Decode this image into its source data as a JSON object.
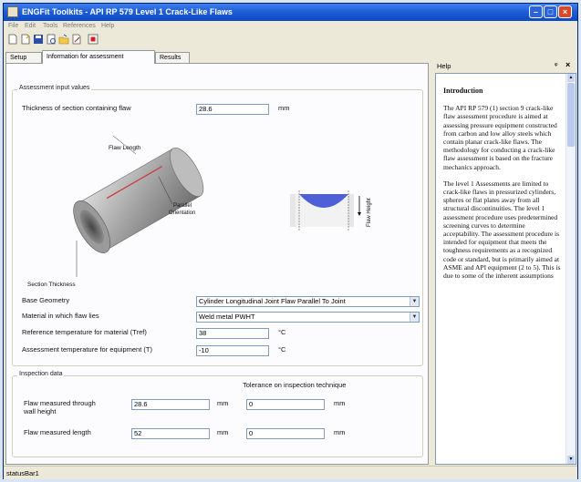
{
  "window": {
    "title": "ENGFit Toolkits - API RP 579 Level 1 Crack-Like Flaws"
  },
  "menu": {
    "items": [
      "File",
      "Edit",
      "Tools",
      "References",
      "Help"
    ]
  },
  "tabs": [
    "Setup",
    "Information for assessment",
    "Results"
  ],
  "active_tab": 1,
  "assessment": {
    "group_label": "Assessment input values",
    "thickness_label": "Thickness of section containing flaw",
    "thickness_value": "28.6",
    "thickness_unit": "mm",
    "diagram": {
      "flaw_length": "Flaw Length",
      "parallel": "Parallel",
      "orientation": "Orientation",
      "section_thickness": "Section Thickness",
      "flaw_height": "Flaw Height"
    },
    "base_geometry_label": "Base Geometry",
    "base_geometry_value": "Cylinder Longitudinal Joint Flaw Parallel To Joint",
    "material_label": "Material in which flaw lies",
    "material_value": "Weld metal  PWHT",
    "tref_label": "Reference temperature for material (Tref)",
    "tref_value": "38",
    "tref_unit": "°C",
    "t_label": "Assessment temperature for equipment (T)",
    "t_value": "-10",
    "t_unit": "°C"
  },
  "inspection": {
    "group_label": "Inspection data",
    "tolerance_label": "Tolerance on inspection technique",
    "height_label_1": "Flaw measured through",
    "height_label_2": "wall height",
    "height_value": "28.6",
    "height_unit": "mm",
    "height_tol": "0",
    "height_tol_unit": "mm",
    "length_label": "Flaw measured length",
    "length_value": "52",
    "length_unit": "mm",
    "length_tol": "0",
    "length_tol_unit": "mm"
  },
  "help": {
    "title": "Help",
    "pin": "ᵠ",
    "close": "×",
    "heading": "Introduction",
    "para1": "The API RP 579 (1) section 9 crack-like flaw assessment procedure is aimed at assessing pressure equipment constructed from carbon and low alloy steels which contain planar crack-like flaws. The methodology for conducting a crack-like flaw assessment is based on the fracture mechanics approach.",
    "para2": "The level 1 Assessments are limited to crack-like flaws in pressurized cylinders, spheres or flat plates away from all structural discontinuities. The level 1 assessment procedure uses predetermined screening curves to determine acceptability. The assessment procedure is intended for equipment that meets the toughness requirements as a recognized code or standard, but is primarily aimed at ASME and API equipment (2 to 5). This is due to some of the inherent assumptions"
  },
  "status": {
    "text": "statusBar1"
  }
}
